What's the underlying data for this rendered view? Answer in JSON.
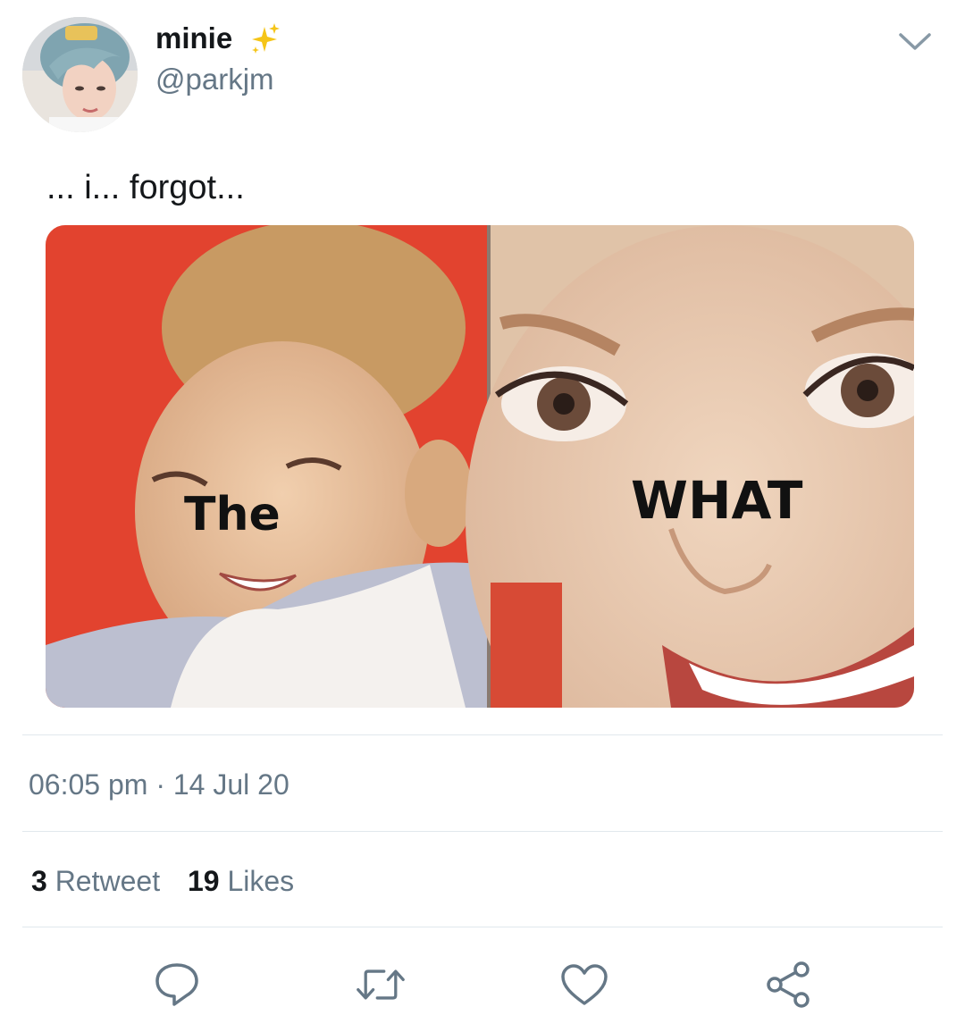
{
  "author": {
    "display_name": "minie",
    "handle": "@parkjm",
    "avatar_icon": "profile-photo",
    "name_emoji_icon": "sparkles-icon"
  },
  "tweet": {
    "text": "... i... forgot...",
    "media": {
      "captions": {
        "left": "The",
        "right": "WHAT"
      }
    },
    "timestamp": "06:05 pm · 14 Jul 20"
  },
  "stats": {
    "retweets_count": "3",
    "retweets_label": "Retweet",
    "likes_count": "19",
    "likes_label": "Likes"
  },
  "actions": {
    "reply_icon": "reply-icon",
    "retweet_icon": "retweet-icon",
    "like_icon": "heart-icon",
    "share_icon": "share-icon"
  },
  "colors": {
    "text_primary": "#14171a",
    "text_secondary": "#657786",
    "divider": "#e1e8ed",
    "sparkle": "#f5c518",
    "icon": "#657786"
  }
}
